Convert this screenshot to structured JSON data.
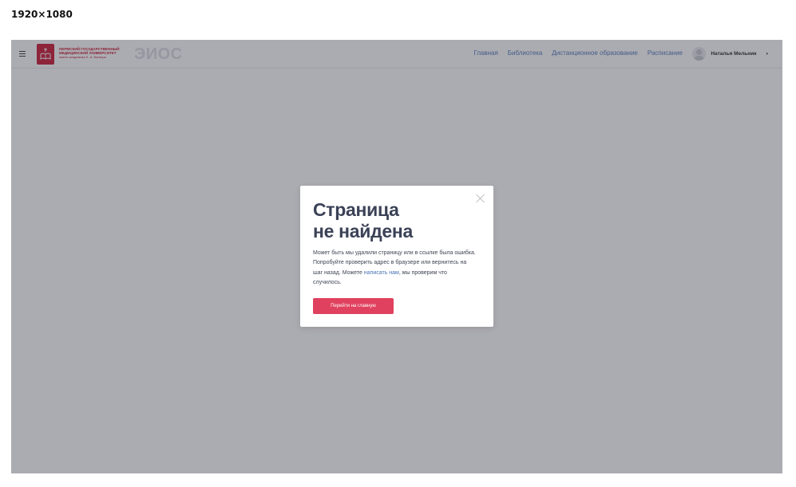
{
  "resolution_label": "1920×1080",
  "header": {
    "university": {
      "line1": "ПЕРМСКИЙ ГОСУДАРСТВЕННЫЙ",
      "line2": "МЕДИЦИНСКИЙ УНИВЕРСИТЕТ",
      "line3": "имени академика Е. А. Вагнера"
    },
    "app_name": "ЭИОС",
    "nav": [
      {
        "label": "Главная"
      },
      {
        "label": "Библиотека"
      },
      {
        "label": "Дистанционное образование"
      },
      {
        "label": "Расписание"
      }
    ],
    "user_name": "Наталья Мельник",
    "user_caret": "▾"
  },
  "modal": {
    "title_line1": "Страница",
    "title_line2": "не найдена",
    "desc_part1": "Может быть мы удалили страницу или в ссылке была ошибка. Попробуйте проверить адрес в браузере или вернитесь на шаг назад. Можете ",
    "desc_link": "написать нам",
    "desc_part2": ", мы проверим что случилось.",
    "button_label": "Перейти на главную"
  },
  "colors": {
    "brand": "#c8102e",
    "link": "#4a72b8",
    "button": "#e0415e",
    "title": "#3b4257"
  },
  "icons": {
    "menu": "burger-menu-icon",
    "close": "close-icon",
    "caret": "chevron-down-icon",
    "avatar": "avatar"
  }
}
